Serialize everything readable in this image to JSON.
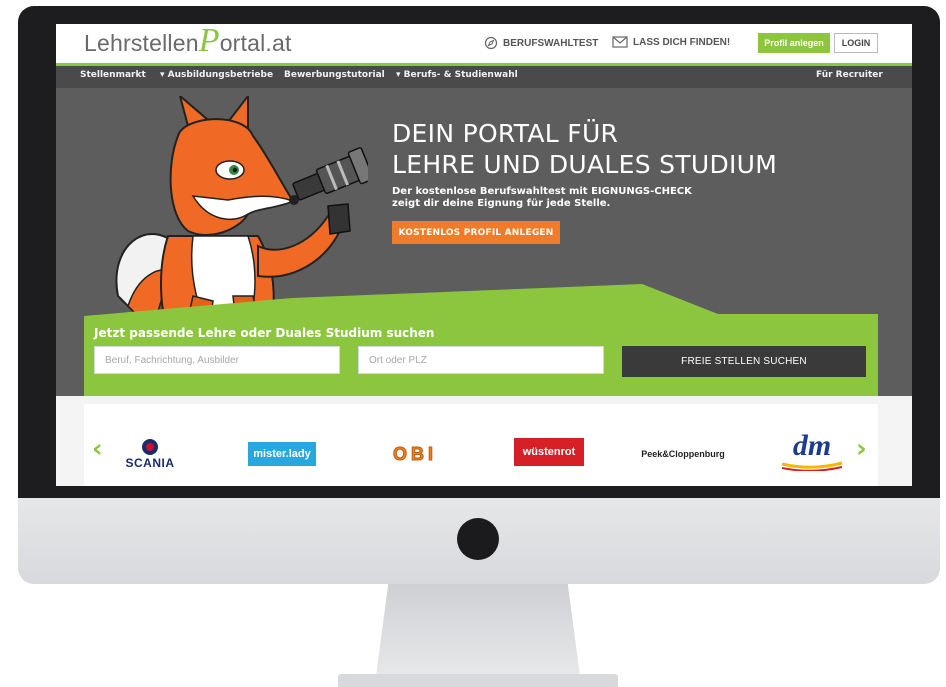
{
  "topbar": {
    "logo_part1": "Lehrstellen",
    "logo_part2": "P",
    "logo_part3": "ortal.at",
    "berufswahltest": "BERUFSWAHLTEST",
    "lass_dich_finden": "LASS DICH FINDEN!",
    "profil_button": "Profil anlegen",
    "login_button": "LOGIN"
  },
  "nav": {
    "items": [
      "Stellenmarkt",
      "Ausbildungsbetriebe",
      "Bewerbungstutorial",
      "Berufs- & Studienwahl"
    ],
    "right": "Für Recruiter"
  },
  "hero": {
    "title_line1": "DEIN PORTAL FÜR",
    "title_line2": "LEHRE UND DUALES STUDIUM",
    "sub_line1": "Der kostenlose Berufswahltest mit EIGNUNGS-CHECK",
    "sub_line2": "zeigt dir deine Eignung für jede Stelle.",
    "cta": "KOSTENLOS PROFIL ANLEGEN"
  },
  "search": {
    "title": "Jetzt passende Lehre oder Duales Studium suchen",
    "job_placeholder": "Beruf, Fachrichtung, Ausbilder",
    "location_placeholder": "Ort oder PLZ",
    "button": "FREIE STELLEN SUCHEN"
  },
  "partners": {
    "prev": "‹",
    "next": "›",
    "logos": [
      "SCANIA",
      "mister.lady",
      "OBI",
      "wüstenrot",
      "Peek&Cloppenburg",
      "dm"
    ]
  },
  "colors": {
    "accent_green": "#8cc63f",
    "cta_orange": "#f07c2a",
    "hero_gray": "#5d5d5e",
    "nav_gray": "#4a4a4b"
  }
}
